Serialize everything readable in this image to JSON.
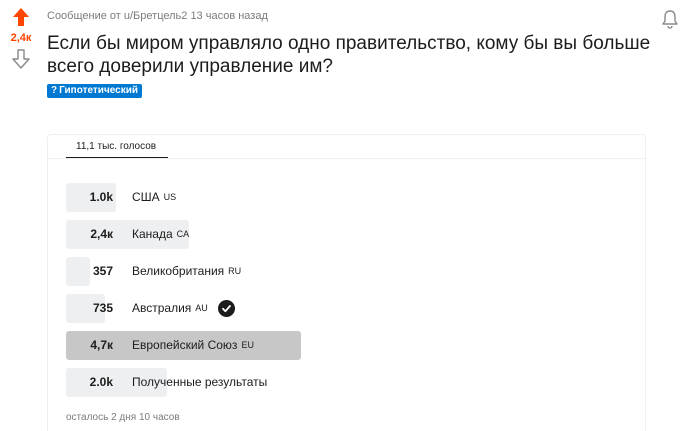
{
  "post": {
    "vote_count": "2,4к",
    "meta": "Сообщение от u/Бретцель2 13 часов назад",
    "title": "Если бы миром управляло одно правительство, кому бы вы больше всего доверили управление им?",
    "flair_icon": "?",
    "flair": "Гипотетический",
    "colors": {
      "upvote": "#ff4500",
      "flair_bg": "#0079d3"
    }
  },
  "poll": {
    "total_votes": "11,1 тыс. голосов",
    "options": [
      {
        "count": "1.0k",
        "label": "США",
        "code": "US",
        "share": 0.09,
        "winner": false,
        "selected": false
      },
      {
        "count": "2,4к",
        "label": "Канада",
        "code": "CA",
        "share": 0.22,
        "winner": false,
        "selected": false
      },
      {
        "count": "357",
        "label": "Великобритания",
        "code": "RU",
        "share": 0.03,
        "winner": false,
        "selected": false
      },
      {
        "count": "735",
        "label": "Австралия",
        "code": "AU",
        "share": 0.07,
        "winner": false,
        "selected": true
      },
      {
        "count": "4,7к",
        "label": "Европейский Союз",
        "code": "EU",
        "share": 0.42,
        "winner": true,
        "selected": false
      },
      {
        "count": "2.0k",
        "label": "Полученные результаты",
        "code": "",
        "share": 0.18,
        "winner": false,
        "selected": false
      }
    ],
    "time_left": "осталось 2 дня 10 часов"
  }
}
